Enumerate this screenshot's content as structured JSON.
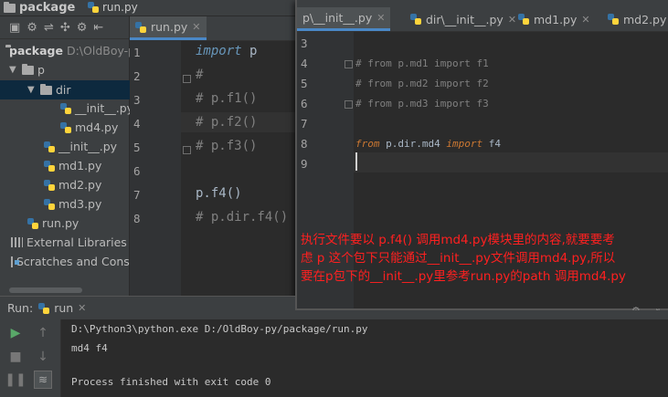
{
  "navbar": {
    "project": "package",
    "file": "run.py"
  },
  "project_panel": {
    "tree": [
      {
        "label": "package",
        "path": "D:\\OldBoy-py",
        "type": "folder"
      },
      {
        "label": "p",
        "type": "folder"
      },
      {
        "label": "dir",
        "type": "folder",
        "selected": true
      },
      {
        "label": "__init__.py",
        "type": "py"
      },
      {
        "label": "md4.py",
        "type": "py"
      },
      {
        "label": "__init__.py",
        "type": "py"
      },
      {
        "label": "md1.py",
        "type": "py"
      },
      {
        "label": "md2.py",
        "type": "py"
      },
      {
        "label": "md3.py",
        "type": "py"
      },
      {
        "label": "run.py",
        "type": "py"
      },
      {
        "label": "External Libraries",
        "type": "lib"
      },
      {
        "label": "Scratches and Consoles",
        "type": "scratch"
      }
    ]
  },
  "left_editor": {
    "tab": "run.py",
    "lines": [
      {
        "n": "1",
        "kw": "import",
        "rest": " p"
      },
      {
        "n": "2",
        "comment": "#"
      },
      {
        "n": "3",
        "comment": "# p.f1()"
      },
      {
        "n": "4",
        "comment": "# p.f2()"
      },
      {
        "n": "5",
        "comment": "# p.f3()"
      },
      {
        "n": "6",
        "text": ""
      },
      {
        "n": "7",
        "text": "p.f4()"
      },
      {
        "n": "8",
        "comment": "# p.dir.f4()"
      }
    ]
  },
  "right_editor": {
    "tabs": [
      {
        "label": "p\\__init__.py",
        "active": true
      },
      {
        "label": "dir\\__init__.py",
        "active": false
      },
      {
        "label": "md1.py",
        "active": false
      },
      {
        "label": "md2.py",
        "active": false
      }
    ],
    "lines": [
      {
        "n": "3",
        "text": ""
      },
      {
        "n": "4",
        "comment": "# from p.md1 import f1"
      },
      {
        "n": "5",
        "comment": "# from p.md2 import f2"
      },
      {
        "n": "6",
        "comment": "# from p.md3 import f3"
      },
      {
        "n": "7",
        "text": ""
      },
      {
        "n": "8",
        "kw1": "from",
        "mid": " p.dir.md4 ",
        "kw2": "import",
        "end": " f4"
      },
      {
        "n": "9",
        "text": ""
      }
    ],
    "annotation": [
      "执行文件要以 p.f4() 调用md4.py模块里的内容,就要要考",
      "虑 p 这个包下只能通过__init__.py文件调用md4.py,所以",
      "要在p包下的__init__.py里参考run.py的path 调用md4.py"
    ]
  },
  "run_panel": {
    "label": "Run:",
    "tab": "run",
    "output": [
      "D:\\Python3\\python.exe D:/OldBoy-py/package/run.py",
      "md4 f4",
      "",
      "Process finished with exit code 0"
    ]
  }
}
